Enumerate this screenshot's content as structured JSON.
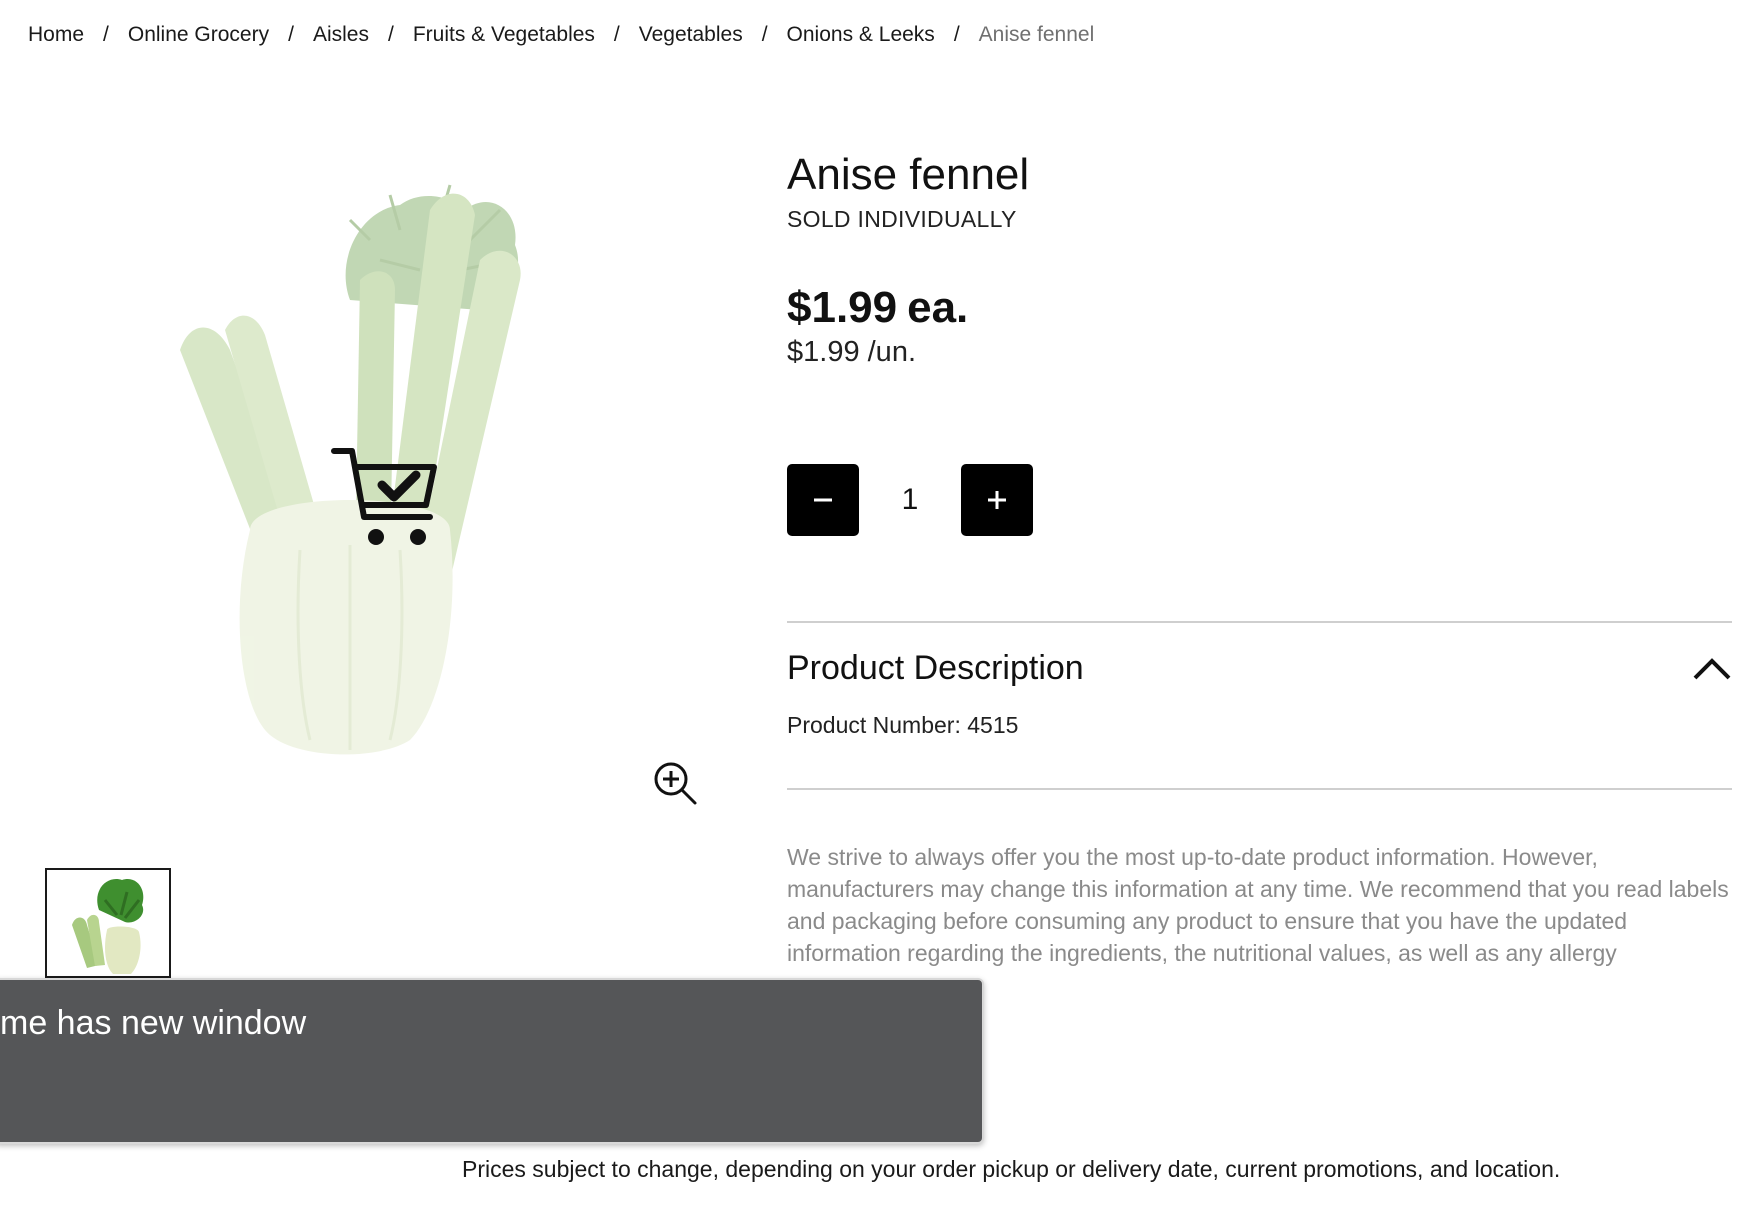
{
  "breadcrumb": {
    "items": [
      "Home",
      "Online Grocery",
      "Aisles",
      "Fruits & Vegetables",
      "Vegetables",
      "Onions & Leeks"
    ],
    "current": "Anise fennel",
    "separator": "/"
  },
  "product": {
    "title": "Anise fennel",
    "sold_as": "SOLD INDIVIDUALLY",
    "price": "$1.99",
    "price_unit": "ea.",
    "unit_price": "$1.99 /un.",
    "quantity": "1",
    "product_number": "Product Number: 4515",
    "image_icon": "fennel-bulb",
    "in_cart": true
  },
  "quantity_controls": {
    "decrement_icon": "minus-icon",
    "increment_icon": "plus-icon"
  },
  "description": {
    "title": "Product Description",
    "expanded": true,
    "toggle_icon": "chevron-up-icon"
  },
  "disclaimer": "We strive to always offer you the most up-to-date product information. However, manufacturers may change this information at any time. We recommend that you read labels and packaging before consuming any product to ensure that you have the updated information regarding the ingredients, the nutritional values, as well as any allergy",
  "toast": {
    "text": "me has new window"
  },
  "footer": {
    "note": "Prices subject to change, depending on your order pickup or delivery date, current promotions, and location."
  },
  "colors": {
    "button_bg": "#000000",
    "toast_bg": "#555658",
    "muted_text": "#8a8a8a",
    "rule": "#cfcfcf"
  }
}
